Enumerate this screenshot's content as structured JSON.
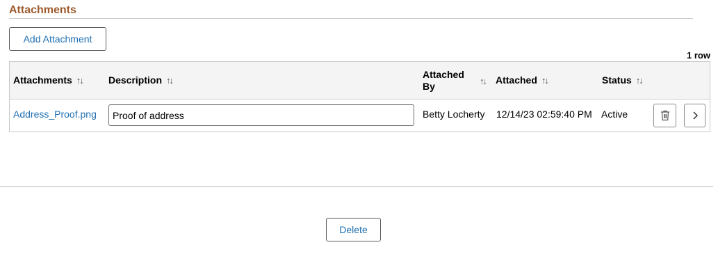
{
  "section": {
    "title": "Attachments"
  },
  "toolbar": {
    "add_label": "Add Attachment"
  },
  "grid": {
    "row_count": "1 row",
    "columns": [
      "Attachments",
      "Description",
      "Attached By",
      "Attached",
      "Status"
    ],
    "column_lines": {
      "attached_by_1": "Attached",
      "attached_by_2": "By"
    },
    "rows": [
      {
        "attachment": "Address_Proof.png",
        "description": "Proof of address",
        "attached_by": "Betty Locherty",
        "attached": "12/14/23 02:59:40 PM",
        "status": "Active"
      }
    ]
  },
  "icons": {
    "sort": "sort-arrows-icon",
    "delete": "trash-icon",
    "detail": "chevron-right-icon"
  },
  "footer": {
    "delete_label": "Delete"
  },
  "colors": {
    "title": "#9c5a2c",
    "link": "#1f6fb2"
  }
}
